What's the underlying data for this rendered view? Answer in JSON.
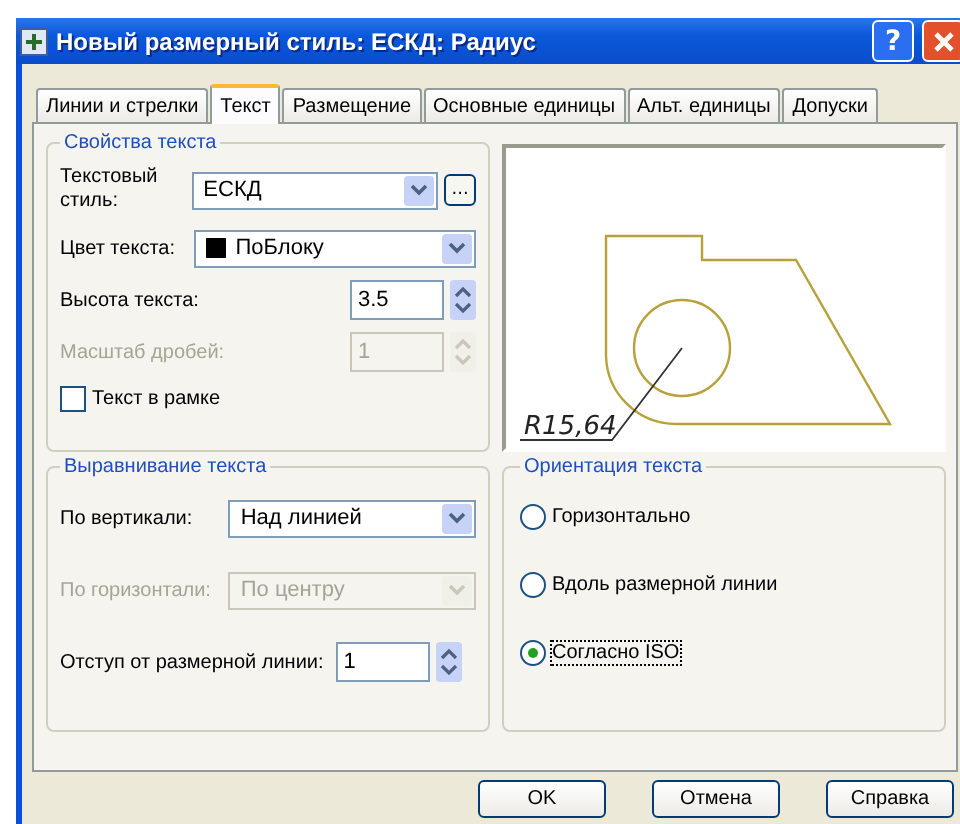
{
  "window": {
    "title": "Новый размерный стиль: ЕСКД: Радиус",
    "help": "?"
  },
  "tabs": [
    {
      "label": "Линии и стрелки",
      "selected": false
    },
    {
      "label": "Текст",
      "selected": true
    },
    {
      "label": "Размещение",
      "selected": false
    },
    {
      "label": "Основные единицы",
      "selected": false
    },
    {
      "label": "Альт. единицы",
      "selected": false
    },
    {
      "label": "Допуски",
      "selected": false
    }
  ],
  "text_properties": {
    "title": "Свойства текста",
    "style": {
      "label": "Текстовый стиль:",
      "value": "ЕСКД",
      "browse": "..."
    },
    "color": {
      "label": "Цвет текста:",
      "value": "ПоБлоку"
    },
    "height": {
      "label": "Высота текста:",
      "value": "3.5",
      "disabled": false
    },
    "fraction_scale": {
      "label": "Масштаб дробей:",
      "value": "1",
      "disabled": true
    },
    "frame": {
      "label": "Текст в рамке",
      "checked": false
    }
  },
  "preview": {
    "dimension": "R15,64"
  },
  "alignment": {
    "title": "Выравнивание текста",
    "vertical": {
      "label": "По вертикали:",
      "value": "Над линией",
      "disabled": false
    },
    "horizontal": {
      "label": "По горизонтали:",
      "value": "По центру",
      "disabled": true
    },
    "offset": {
      "label": "Отступ от размерной линии:",
      "value": "1"
    }
  },
  "orientation": {
    "title": "Ориентация текста",
    "options": [
      {
        "label": "Горизонтально",
        "selected": false
      },
      {
        "label": "Вдоль размерной линии",
        "selected": false
      },
      {
        "label": "Согласно ISO",
        "selected": true
      }
    ]
  },
  "buttons": [
    "OK",
    "Отмена",
    "Справка"
  ]
}
